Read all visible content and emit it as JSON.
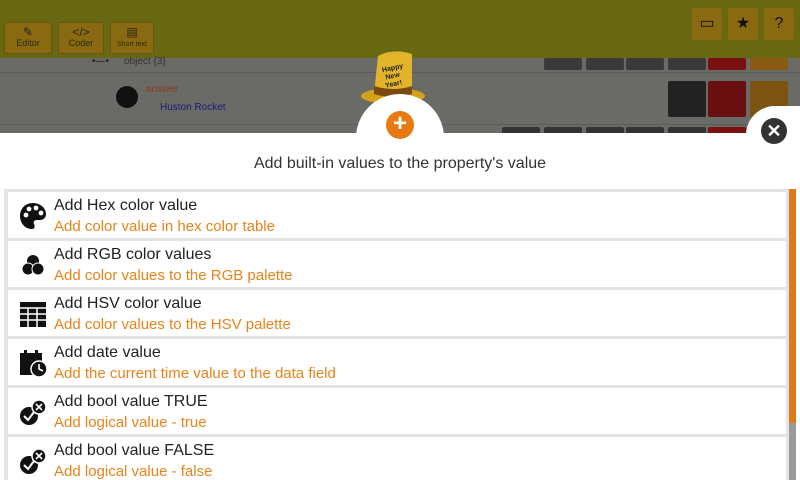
{
  "toolbar": {
    "editor_label": "Editor",
    "coder_label": "Coder",
    "shorttext_label": "Short text"
  },
  "background": {
    "object_label": "object {3}",
    "answer_label": "answer",
    "answer_value": "Huston Rocket"
  },
  "dialog": {
    "title": "Add built-in values to the property's value",
    "hat_text": "Happy New Year!",
    "items": [
      {
        "title": "Add Hex color value",
        "subtitle": "Add color value in hex color table",
        "icon": "palette-icon"
      },
      {
        "title": "Add RGB color values",
        "subtitle": "Add color values to the RGB palette",
        "icon": "rgb-circles-icon"
      },
      {
        "title": "Add HSV color value",
        "subtitle": "Add color values to the HSV palette",
        "icon": "grid-table-icon"
      },
      {
        "title": "Add date value",
        "subtitle": "Add the current time value to the data field",
        "icon": "calendar-clock-icon"
      },
      {
        "title": "Add bool value TRUE",
        "subtitle": "Add logical value - true",
        "icon": "bool-check-icon"
      },
      {
        "title": "Add bool value FALSE",
        "subtitle": "Add logical value - false",
        "icon": "bool-check-icon"
      }
    ]
  },
  "colors": {
    "accent": "#e87a14",
    "subtitle": "#e6841c",
    "topbar": "#686812"
  }
}
